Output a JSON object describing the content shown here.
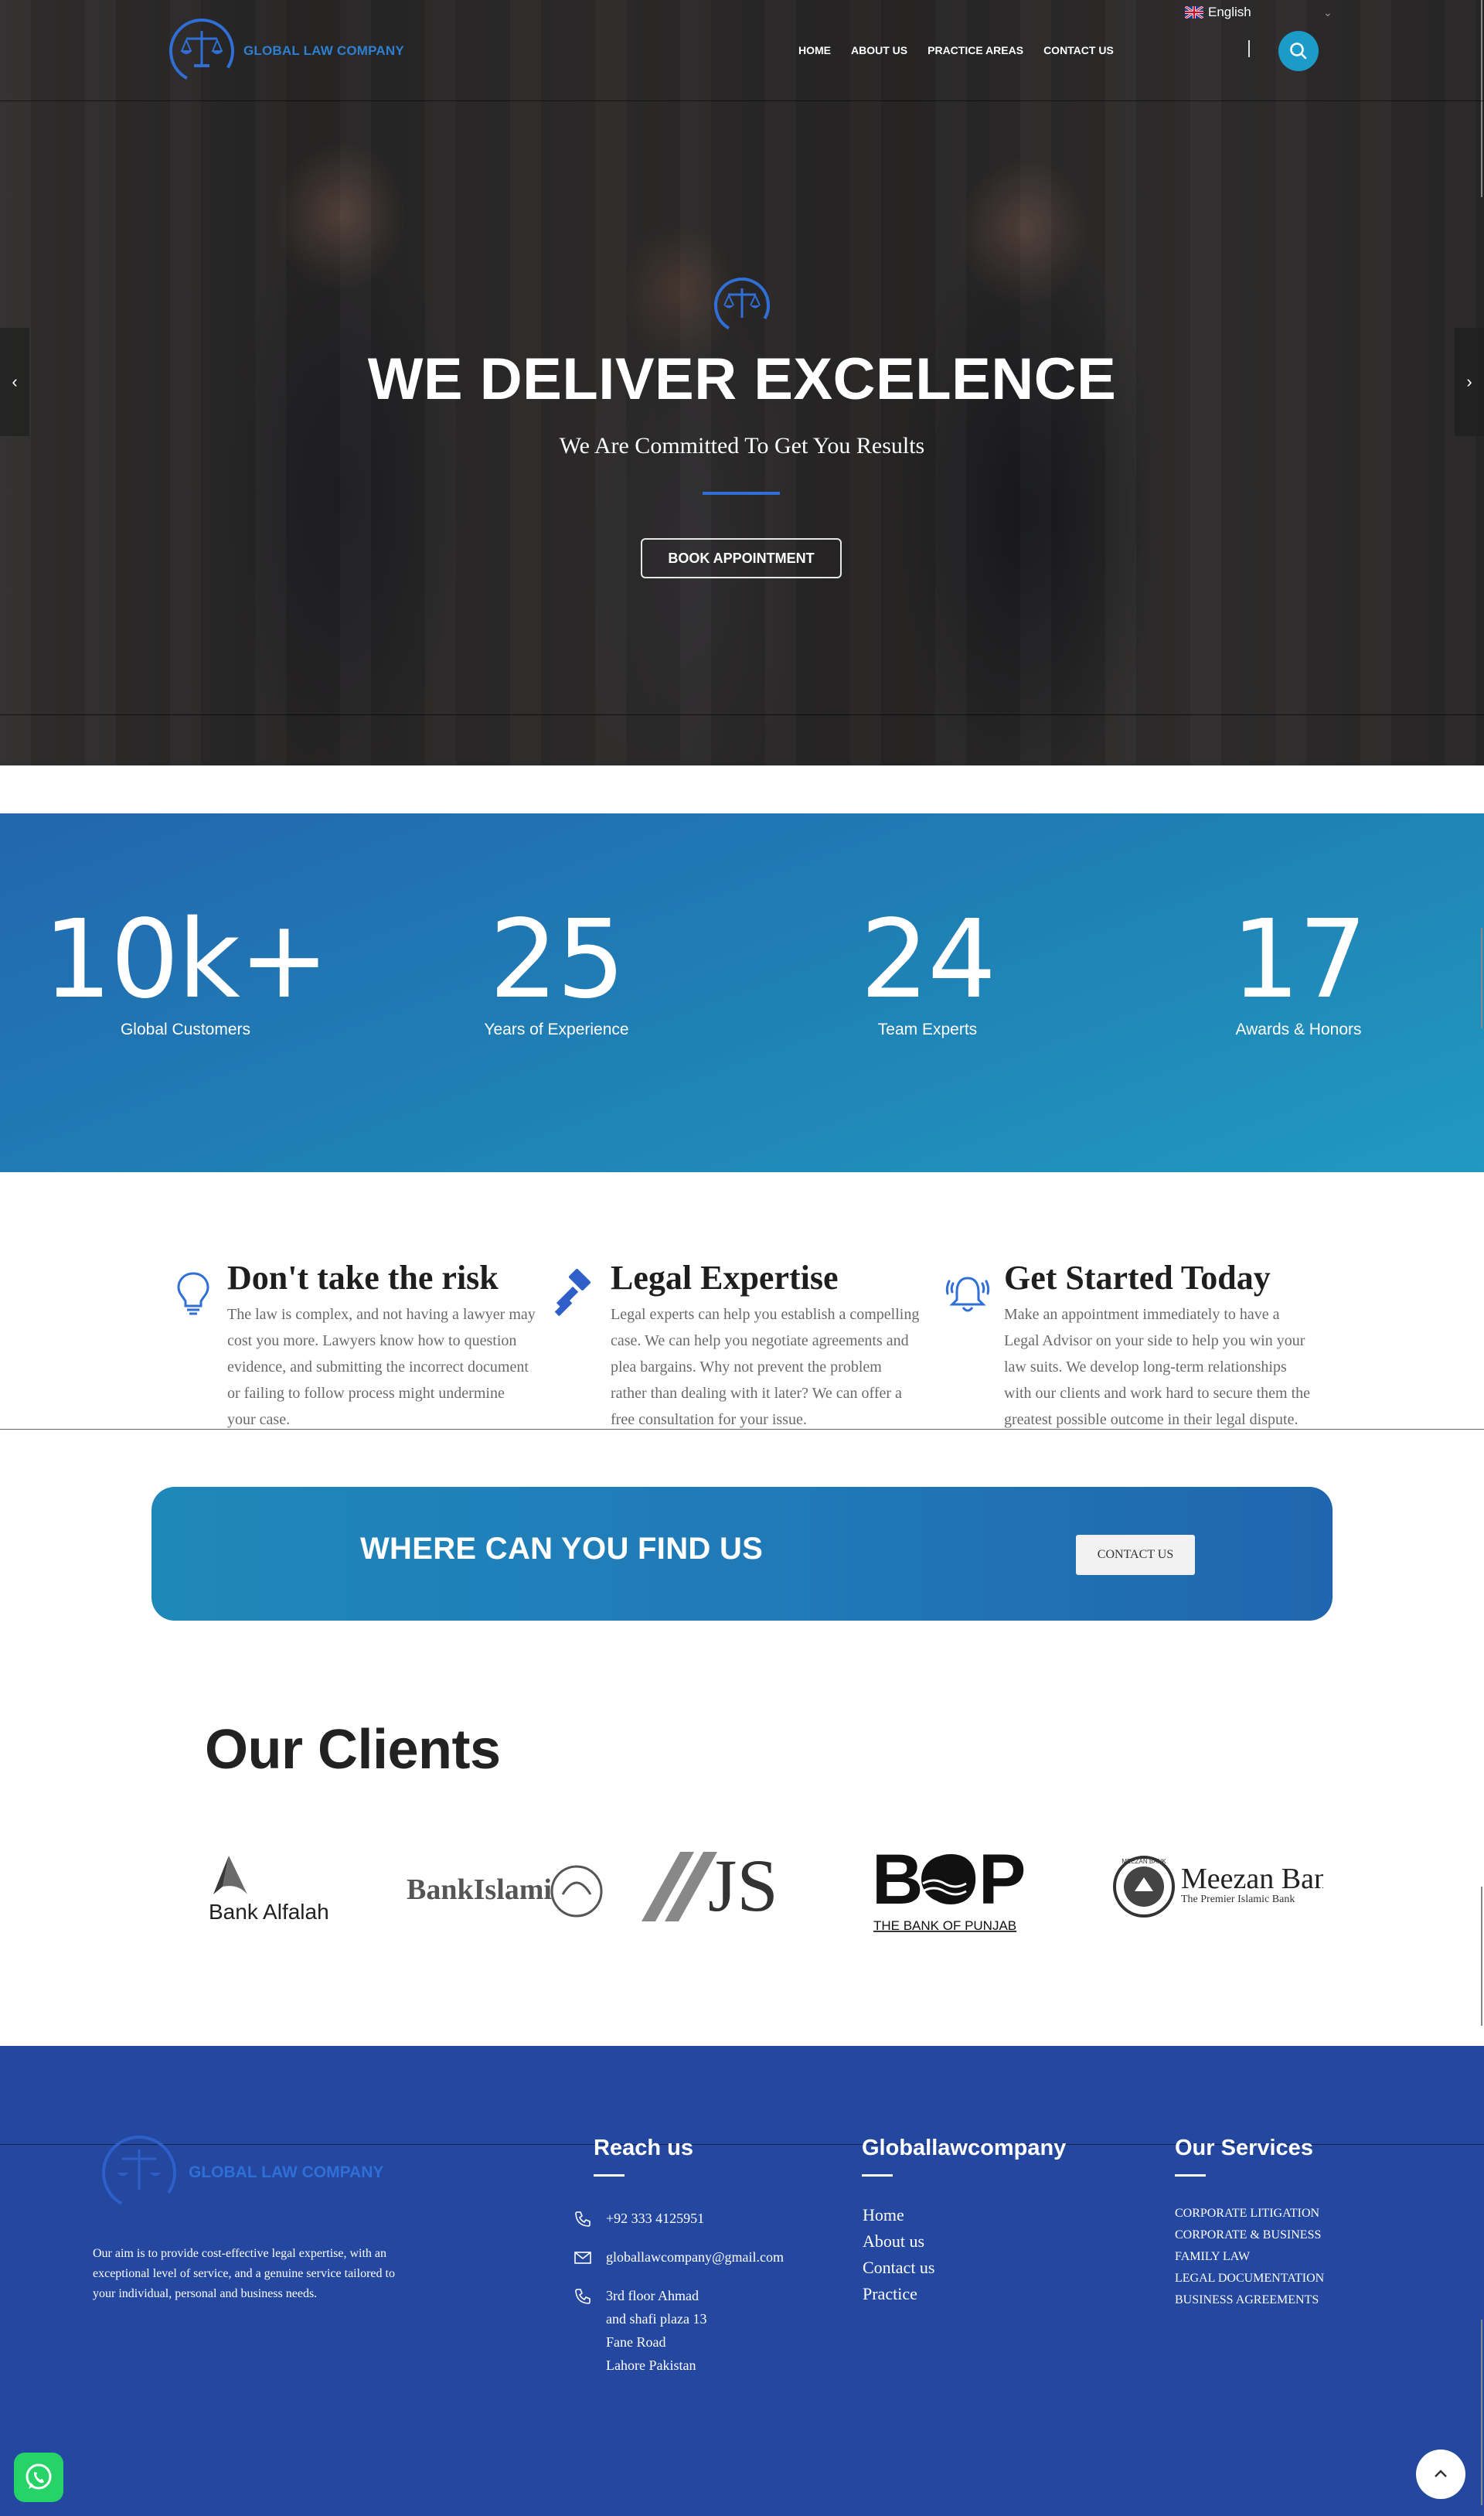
{
  "header": {
    "logo_text": "GLOBAL LAW COMPANY",
    "nav": [
      "HOME",
      "ABOUT US",
      "PRACTICE AREAS",
      "CONTACT US"
    ],
    "language": "English"
  },
  "hero": {
    "title": "WE DELIVER EXCELENCE",
    "subtitle": "We Are Committed To Get You Results",
    "button": "BOOK APPOINTMENT",
    "prev": "‹",
    "next": "›"
  },
  "stats": [
    {
      "value": "10k+",
      "label": "Global Customers"
    },
    {
      "value": "25",
      "label": "Years of Experience"
    },
    {
      "value": "24",
      "label": "Team Experts"
    },
    {
      "value": "17",
      "label": "Awards & Honors"
    }
  ],
  "features": [
    {
      "title": "Don't take the risk",
      "icon": "lightbulb-icon",
      "text": "The law is complex, and not having a lawyer may cost you more. Lawyers know how to question evidence, and submitting the incorrect document or failing to follow process might undermine your case."
    },
    {
      "title": "Legal Expertise",
      "icon": "gavel-icon",
      "text": "Legal experts can help you establish a compelling case. We can help you negotiate agreements and plea bargains. Why not prevent the problem rather than dealing with it later? We can offer a free consultation for your issue."
    },
    {
      "title": "Get Started Today",
      "icon": "bell-icon",
      "text": "Make an appointment immediately to have a Legal Advisor on your side to help you win your law suits. We develop long-term relationships with our clients and work hard to secure them the greatest possible outcome in their legal dispute."
    }
  ],
  "cta": {
    "title": "WHERE CAN YOU FIND US",
    "button": "CONTACT US"
  },
  "clients": {
    "title": "Our Clients",
    "logos": [
      {
        "name": "Bank Alfalah"
      },
      {
        "name": "BankIslami"
      },
      {
        "name": "JS"
      },
      {
        "name": "BOP",
        "tagline": "THE BANK OF PUNJAB"
      },
      {
        "name": "Meezan Bank",
        "tagline": "The Premier Islamic Bank",
        "seal": "MEEZAN BANK"
      }
    ]
  },
  "footer": {
    "logo_text": "GLOBAL LAW COMPANY",
    "about": "Our aim is to provide cost-effective legal expertise, with an exceptional level of service, and a genuine service tailored to your individual, personal and business needs.",
    "reach_title": "Reach us",
    "phone": "+92 333 4125951",
    "email": "globallawcompany@gmail.com",
    "address": [
      "3rd floor Ahmad",
      "and shafi plaza 13",
      "Fane Road",
      "Lahore Pakistan"
    ],
    "links_title": "Globallawcompany",
    "links": [
      "Home",
      "About us",
      "Contact us",
      "Practice"
    ],
    "services_title": "Our Services",
    "services": [
      "CORPORATE LITIGATION",
      "CORPORATE & BUSINESS",
      "FAMILY LAW",
      "LEGAL DOCUMENTATION",
      "BUSINESS AGREEMENTS"
    ]
  },
  "colors": {
    "accent_blue": "#1d9bc8",
    "footer_blue": "#2447a0",
    "stats_gradient_start": "#2266ae",
    "stats_gradient_end": "#2199c0"
  }
}
